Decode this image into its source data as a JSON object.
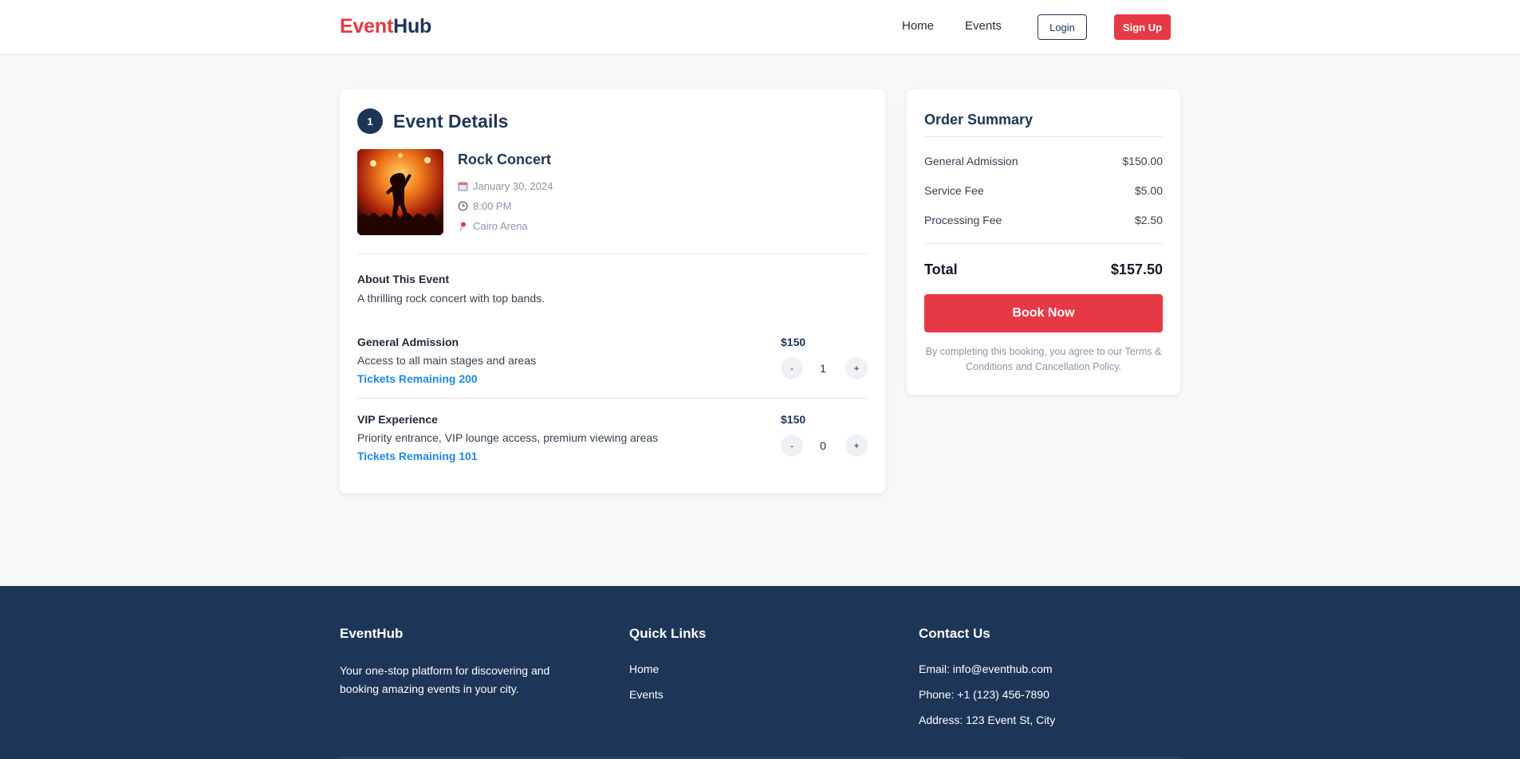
{
  "header": {
    "logo_part1": "Event",
    "logo_part2": "Hub",
    "nav": {
      "home": "Home",
      "events": "Events"
    },
    "login_label": "Login",
    "signup_label": "Sign Up"
  },
  "event_details": {
    "step_number": "1",
    "section_title": "Event Details",
    "event_name": "Rock Concert",
    "date": "January 30, 2024",
    "time": "8:00 PM",
    "location": "Cairo Arena",
    "about_title": "About This Event",
    "about_text": "A thrilling rock concert with top bands.",
    "tickets": [
      {
        "name": "General Admission",
        "description": "Access to all main stages and areas",
        "remaining": "Tickets Remaining 200",
        "price": "$150",
        "quantity": "1",
        "minus_label": "-",
        "plus_label": "+"
      },
      {
        "name": "VIP Experience",
        "description": "Priority entrance, VIP lounge access, premium viewing areas",
        "remaining": "Tickets Remaining 101",
        "price": "$150",
        "quantity": "0",
        "minus_label": "-",
        "plus_label": "+"
      }
    ]
  },
  "order_summary": {
    "title": "Order Summary",
    "lines": [
      {
        "label": "General Admission",
        "amount": "$150.00"
      },
      {
        "label": "Service Fee",
        "amount": "$5.00"
      },
      {
        "label": "Processing Fee",
        "amount": "$2.50"
      }
    ],
    "total_label": "Total",
    "total_amount": "$157.50",
    "book_label": "Book Now",
    "terms": "By completing this booking, you agree to our Terms & Conditions and Cancellation Policy."
  },
  "footer": {
    "brand_title": "EventHub",
    "brand_text": "Your one-stop platform for discovering and booking amazing events in your city.",
    "quick_links_title": "Quick Links",
    "quick_links": [
      "Home",
      "Events"
    ],
    "contact_title": "Contact Us",
    "contact": {
      "email": "Email: info@eventhub.com",
      "phone": "Phone: +1 (123) 456-7890",
      "address": "Address: 123 Event St, City"
    }
  },
  "colors": {
    "brand_red": "#e63946",
    "brand_navy": "#1d3557",
    "link_blue": "#1e88e5",
    "page_bg": "#f7f8fa"
  },
  "icons": [
    "calendar-icon",
    "clock-icon",
    "location-pin-icon"
  ]
}
